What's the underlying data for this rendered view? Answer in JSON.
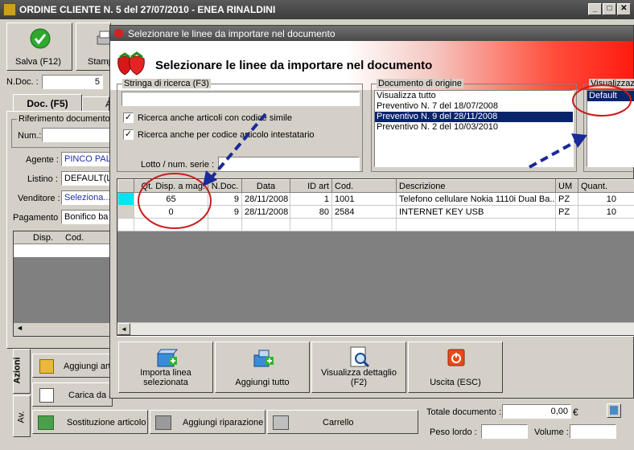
{
  "main": {
    "title": "ORDINE CLIENTE N. 5  del 27/07/2010 - ENEA RINALDINI",
    "toolbar": {
      "save": "Salva (F12)",
      "print": "Stamp"
    },
    "ndoc_label": "N.Doc. :",
    "ndoc_value": "5",
    "tabs": {
      "doc": "Doc. (F5)",
      "a": "A"
    },
    "rif_doc": "Riferimento documento",
    "num_label": "Num.:",
    "agente_label": "Agente :",
    "agente_value": "PINCO PAL",
    "listino_label": "Listino :",
    "listino_value": "DEFAULT(L",
    "venditore_label": "Venditore :",
    "venditore_value": "Seleziona...",
    "pagamento_label": "Pagamento :",
    "pagamento_value": "Bonifico ba",
    "grid_cols": [
      "Disp.",
      "Cod."
    ],
    "side_tabs": {
      "azioni": "Azioni",
      "av": "Av."
    },
    "actions": {
      "aggiungi_art": "Aggiungi arti",
      "carica": "Carica da a",
      "sostituzione": "Sostituzione articolo",
      "riparazione": "Aggiungi riparazione",
      "carrello": "Carrello"
    },
    "totale_label": "Totale documento :",
    "totale_value": "0,00",
    "currency": "€",
    "peso_label": "Peso lordo :",
    "volume_label": "Volume :"
  },
  "dialog": {
    "title": "Selezionare le linee da importare nel documento",
    "banner": "Selezionare le linee da importare nel documento",
    "search_group": "Stringa di ricerca (F3)",
    "search_value": "",
    "check1": "Ricerca anche articoli con codice simile",
    "check2": "Ricerca anche per codice articolo intestatario",
    "lotto_label": "Lotto / num. serie :",
    "origin_group": "Documento di origine",
    "origin_items": [
      "Visualizza tutto",
      "Preventivo N. 7 del 18/07/2008",
      "Preventivo N. 9 del 28/11/2008",
      "Preventivo N. 2 del 10/03/2010"
    ],
    "view_group": "Visualizzazio",
    "view_items": [
      "Default"
    ],
    "columns": [
      "Qt. Disp. a mag.",
      "N.Doc.",
      "Data",
      "ID art",
      "Cod.",
      "Descrizione",
      "UM",
      "Quant."
    ],
    "rows": [
      [
        "65",
        "9",
        "28/11/2008",
        "1",
        "1001",
        "Telefono cellulare Nokia 1110i Dual Ba...",
        "PZ",
        "10"
      ],
      [
        "0",
        "9",
        "28/11/2008",
        "80",
        "2584",
        "INTERNET KEY USB",
        "PZ",
        "10"
      ]
    ],
    "buttons": {
      "import": "Importa linea selezionata",
      "add_all": "Aggiungi tutto",
      "detail": "Visualizza dettaglio (F2)",
      "exit": "Uscita (ESC)"
    }
  }
}
